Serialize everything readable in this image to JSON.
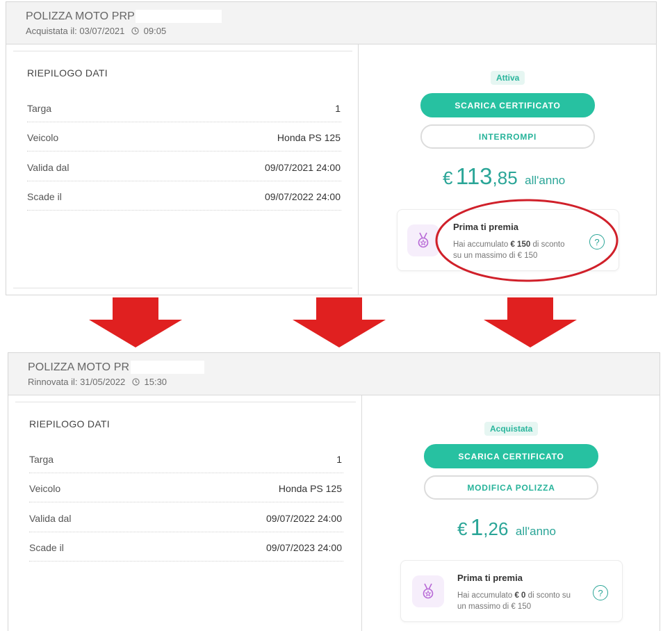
{
  "policies": [
    {
      "title": "POLIZZA MOTO PRP",
      "purchase_label": "Acquistata il:",
      "date": "03/07/2021",
      "time": "09:05",
      "summary_title": "RIEPILOGO DATI",
      "rows": [
        {
          "label": "Targa",
          "value": "1"
        },
        {
          "label": "Veicolo",
          "value": "Honda PS 125"
        },
        {
          "label": "Valida dal",
          "value": "09/07/2021 24:00"
        },
        {
          "label": "Scade il",
          "value": "09/07/2022 24:00"
        }
      ],
      "status_badge": "Attiva",
      "primary_button": "SCARICA CERTIFICATO",
      "secondary_button": "INTERROMPI",
      "price_currency": "€",
      "price_int": "113",
      "price_dec": ",85",
      "price_period": "all'anno",
      "reward_title": "Prima ti premia",
      "reward_pre": "Hai accumulato",
      "reward_amount": "€ 150",
      "reward_mid": "di sconto",
      "reward_post": "su un massimo di € 150",
      "help_symbol": "?"
    },
    {
      "title": "POLIZZA MOTO PR",
      "purchase_label": "Rinnovata il:",
      "date": "31/05/2022",
      "time": "15:30",
      "summary_title": "RIEPILOGO DATI",
      "rows": [
        {
          "label": "Targa",
          "value": "1"
        },
        {
          "label": "Veicolo",
          "value": "Honda PS 125"
        },
        {
          "label": "Valida dal",
          "value": "09/07/2022 24:00"
        },
        {
          "label": "Scade il",
          "value": "09/07/2023 24:00"
        }
      ],
      "status_badge": "Acquistata",
      "primary_button": "SCARICA CERTIFICATO",
      "secondary_button": "MODIFICA POLIZZA",
      "price_currency": "€",
      "price_int": "1",
      "price_dec": ",26",
      "price_period": "all'anno",
      "reward_title": "Prima ti premia",
      "reward_pre": "Hai accumulato",
      "reward_amount": "€ 0",
      "reward_mid": "di sconto su",
      "reward_post": "un massimo di € 150",
      "help_symbol": "?"
    }
  ],
  "colors": {
    "accent": "#27c1a1",
    "price": "#2aa597",
    "arrow": "#e02020",
    "highlight": "#d0202a"
  },
  "icons": [
    "clock-icon",
    "medal-icon",
    "help-icon",
    "arrow-down-icon"
  ]
}
